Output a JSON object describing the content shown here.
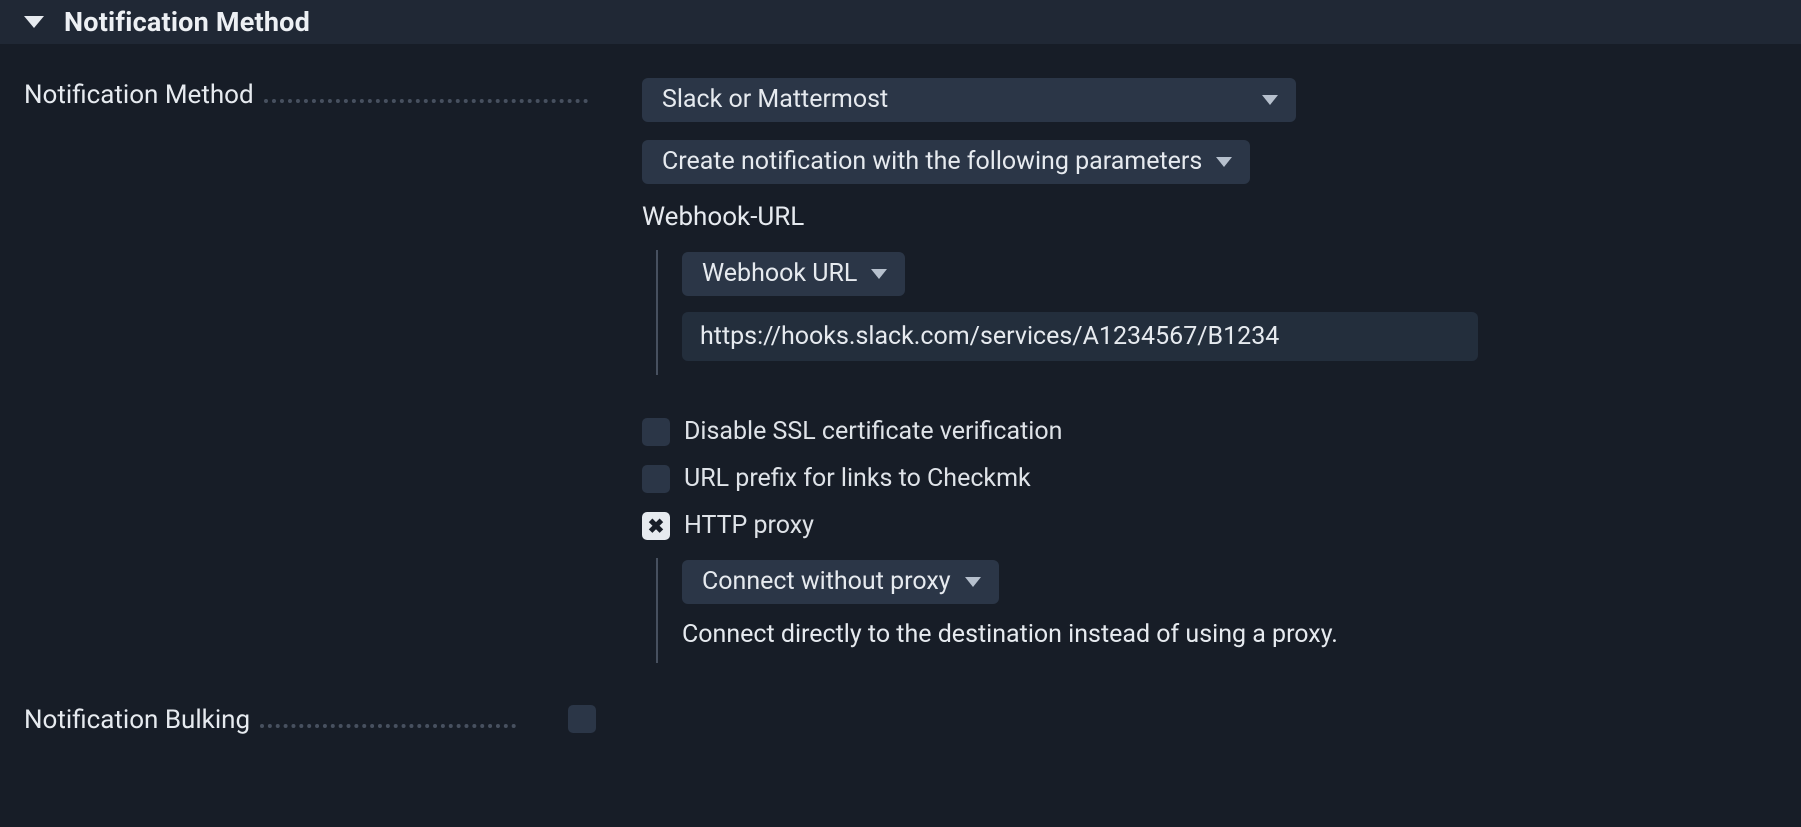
{
  "section": {
    "title": "Notification Method"
  },
  "method": {
    "label": "Notification Method",
    "value": "Slack or Mattermost",
    "mode": "Create notification with the following parameters"
  },
  "webhook": {
    "heading": "Webhook-URL",
    "type_selected": "Webhook URL",
    "url_value": "https://hooks.slack.com/services/A1234567/B1234"
  },
  "options": {
    "disable_ssl": "Disable SSL certificate verification",
    "url_prefix": "URL prefix for links to Checkmk",
    "http_proxy": "HTTP proxy"
  },
  "proxy": {
    "selected": "Connect without proxy",
    "description": "Connect directly to the destination instead of using a proxy."
  },
  "bulking": {
    "label": "Notification Bulking"
  }
}
